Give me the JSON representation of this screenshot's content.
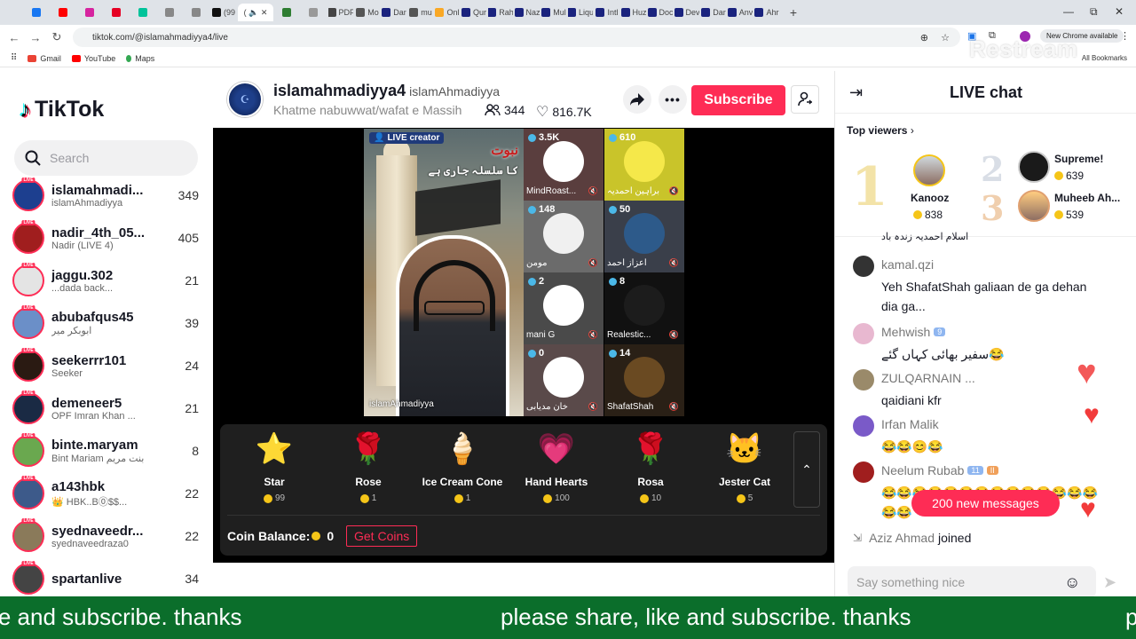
{
  "browser": {
    "url": "tiktok.com/@islamahmadiyya4/live",
    "active_tab_label": "(",
    "tabs": [
      "(99",
      "PDF",
      "Mo",
      "Dar",
      "mu",
      "Onl",
      "Qur",
      "Rah",
      "Naz",
      "Mul",
      "Liqu",
      "Intl",
      "Huz",
      "Doc",
      "Dev",
      "Dar",
      "Anv",
      "Ahr"
    ],
    "new_chrome_label": "New Chrome available",
    "bookmarks": [
      "Gmail",
      "YouTube",
      "Maps"
    ],
    "all_bookmarks": "All Bookmarks",
    "overlay_watermark": "Restream"
  },
  "sidebar": {
    "logo": "TikTok",
    "search_placeholder": "Search",
    "live_tag": "LIVE",
    "creators": [
      {
        "name": "islamahmadi...",
        "sub": "islamAhmadiyya",
        "count": "349",
        "color": "#1d3f8f"
      },
      {
        "name": "nadir_4th_05...",
        "sub": "Nadir (LIVE 4)",
        "count": "405",
        "color": "#a01e1e"
      },
      {
        "name": "jaggu.302",
        "sub": "...dada back...",
        "count": "21",
        "color": "#e4e4e4"
      },
      {
        "name": "abubafqus45",
        "sub": "ابوبکر میر",
        "count": "39",
        "color": "#6b8fc8"
      },
      {
        "name": "seekerrr101",
        "sub": "Seeker",
        "count": "24",
        "color": "#2a1a12"
      },
      {
        "name": "demeneer5",
        "sub": "OPF Imran Khan ...",
        "count": "21",
        "color": "#1a2a44"
      },
      {
        "name": "binte.maryam",
        "sub": "Bint Mariam بنت مریم",
        "count": "8",
        "color": "#6aa84f"
      },
      {
        "name": "a143hbk",
        "sub": "👑 HBK..B⓪$$...",
        "count": "22",
        "color": "#3d5a8a"
      },
      {
        "name": "syednaveedr...",
        "sub": "syednaveedraza0",
        "count": "22",
        "color": "#8a7a5a"
      },
      {
        "name": "spartanlive",
        "sub": "",
        "count": "34",
        "color": "#444"
      }
    ]
  },
  "stream": {
    "host_name": "islamahmadiyya4",
    "host_handle": "islamAhmadiyya",
    "title": "Khatme nabuwwat/wafat e Massih",
    "viewers": "344",
    "likes": "816.7K",
    "subscribe_label": "Subscribe",
    "live_creator_label": "LIVE creator",
    "main_name": "islamAhmadiyya",
    "banner_line1": "نبوت",
    "banner_line2": "کا سلسلہ جاری ہے",
    "guests": [
      {
        "badge": "3.5K",
        "name": "MindRoast...",
        "bg": "#5a3e3e",
        "av": "#ffffff"
      },
      {
        "badge": "610",
        "name": "براہین احمدیہ",
        "bg": "#c9c42a",
        "av": "#f5e84a"
      },
      {
        "badge": "148",
        "name": "مومن",
        "bg": "#6b6b6b",
        "av": "#f0f0f0"
      },
      {
        "badge": "50",
        "name": "اعزاز احمد",
        "bg": "#3a3f4a",
        "av": "#2d5a8a"
      },
      {
        "badge": "2",
        "name": "mani G",
        "bg": "#4a4a4a",
        "av": "#ffffff"
      },
      {
        "badge": "8",
        "name": "Realestic...",
        "bg": "#111111",
        "av": "#1c1c1c"
      },
      {
        "badge": "0",
        "name": "خان مدیابی",
        "bg": "#5a4a4a",
        "av": "#ffffff"
      },
      {
        "badge": "14",
        "name": "ShafatShah",
        "bg": "#2a2016",
        "av": "#6a4a22"
      }
    ],
    "gifts": [
      {
        "name": "Star",
        "cost": "99",
        "icon": "⭐"
      },
      {
        "name": "Rose",
        "cost": "1",
        "icon": "🌹"
      },
      {
        "name": "Ice Cream Cone",
        "cost": "1",
        "icon": "🍦"
      },
      {
        "name": "Hand Hearts",
        "cost": "100",
        "icon": "💗"
      },
      {
        "name": "Rosa",
        "cost": "10",
        "icon": "🌹"
      },
      {
        "name": "Jester Cat",
        "cost": "5",
        "icon": "🐱"
      }
    ],
    "coin_balance_label": "Coin Balance:",
    "coin_balance": "0",
    "get_coins_label": "Get Coins"
  },
  "chat": {
    "title": "LIVE chat",
    "top_viewers_label": "Top viewers",
    "top_viewers": [
      {
        "rank": "1",
        "name": "Kanooz",
        "coins": "838"
      },
      {
        "rank": "2",
        "name": "Supreme!",
        "coins": "639"
      },
      {
        "rank": "3",
        "name": "Muheeb Ah...",
        "coins": "539"
      }
    ],
    "partial_message": "اسلام احمدیہ زندہ باد",
    "messages": [
      {
        "name": "kamal.qzi",
        "text": "Yeh ShafatShah galiaan de ga dehan dia ga...",
        "badge": "",
        "color": "#333"
      },
      {
        "name": "Mehwish",
        "text": "سفیر بھائی کہاں گئے😂",
        "badge": "9",
        "color": "#e8b8d0"
      },
      {
        "name": "ZULQARNAIN ...",
        "text": "qaidiani kfr",
        "badge": "",
        "color": "#9a8a6a"
      },
      {
        "name": "Irfan Malik",
        "text": "😂😂😊😂",
        "badge": "",
        "color": "#7a5ac8"
      },
      {
        "name": "Neelum Rubab",
        "text": "😂😂😂😂😂😂😂😂😂😂😂😂😂😂😂😂",
        "badge": "11",
        "badge2": "II",
        "color": "#a01e1e"
      }
    ],
    "new_messages": "200 new messages",
    "joined_name": "Aziz Ahmad",
    "joined_text": "joined",
    "input_placeholder": "Say something nice"
  },
  "ticker": {
    "text": "please share, like and subscribe. thanks"
  }
}
